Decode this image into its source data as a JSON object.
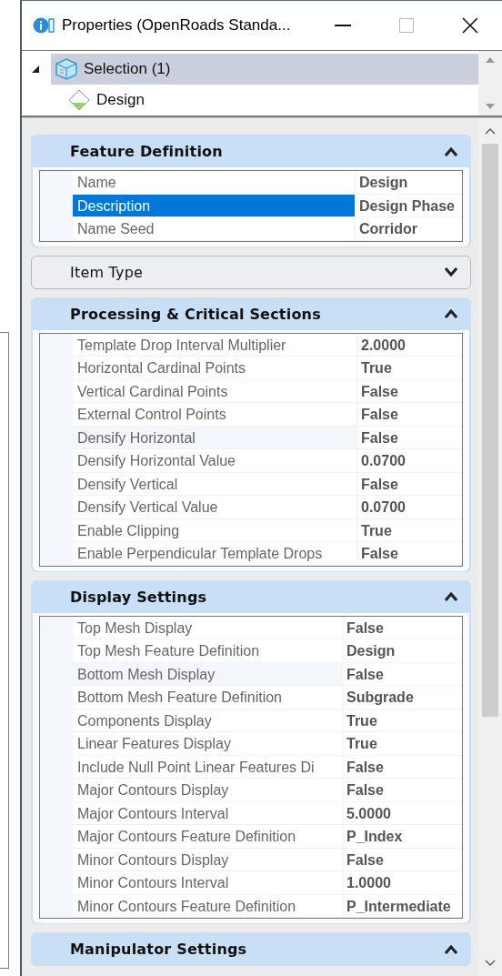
{
  "window": {
    "title": "Properties (OpenRoads Standa..."
  },
  "tree": {
    "items": [
      {
        "label": "Selection (1)",
        "selected": true,
        "expanded": true,
        "children": [
          {
            "label": "Design",
            "selected": false
          }
        ]
      }
    ]
  },
  "sections": [
    {
      "title": "Feature Definition",
      "expanded": true,
      "rows": [
        {
          "label": "Name",
          "value": "Design",
          "selected": false,
          "highlighted": false
        },
        {
          "label": "Description",
          "value": "Design Phase",
          "selected": true,
          "highlighted": false
        },
        {
          "label": "Name Seed",
          "value": "Corridor",
          "selected": false,
          "highlighted": false
        }
      ]
    },
    {
      "title": "Item Type",
      "expanded": false
    },
    {
      "title": "Processing & Critical Sections",
      "expanded": true,
      "rows": [
        {
          "label": "Template Drop Interval Multiplier",
          "value": "2.0000",
          "selected": false,
          "highlighted": false
        },
        {
          "label": "Horizontal Cardinal Points",
          "value": "True",
          "selected": false,
          "highlighted": false
        },
        {
          "label": "Vertical Cardinal Points",
          "value": "False",
          "selected": false,
          "highlighted": false
        },
        {
          "label": "External Control Points",
          "value": "False",
          "selected": false,
          "highlighted": false
        },
        {
          "label": "Densify Horizontal",
          "value": "False",
          "selected": false,
          "highlighted": true
        },
        {
          "label": "Densify Horizontal Value",
          "value": "0.0700",
          "selected": false,
          "highlighted": false
        },
        {
          "label": "Densify Vertical",
          "value": "False",
          "selected": false,
          "highlighted": false
        },
        {
          "label": "Densify Vertical Value",
          "value": "0.0700",
          "selected": false,
          "highlighted": false
        },
        {
          "label": "Enable Clipping",
          "value": "True",
          "selected": false,
          "highlighted": false
        },
        {
          "label": "Enable Perpendicular Template Drops",
          "value": "False",
          "selected": false,
          "highlighted": false
        }
      ]
    },
    {
      "title": "Display Settings",
      "expanded": true,
      "rows": [
        {
          "label": "Top Mesh Display",
          "value": "False",
          "selected": false,
          "highlighted": false
        },
        {
          "label": "Top Mesh Feature Definition",
          "value": "Design",
          "selected": false,
          "highlighted": false
        },
        {
          "label": "Bottom Mesh Display",
          "value": "False",
          "selected": false,
          "highlighted": true
        },
        {
          "label": "Bottom Mesh Feature Definition",
          "value": "Subgrade",
          "selected": false,
          "highlighted": false
        },
        {
          "label": "Components Display",
          "value": "True",
          "selected": false,
          "highlighted": false
        },
        {
          "label": "Linear Features Display",
          "value": "True",
          "selected": false,
          "highlighted": false
        },
        {
          "label": "Include Null Point Linear Features Di",
          "value": "False",
          "selected": false,
          "highlighted": false
        },
        {
          "label": "Major Contours Display",
          "value": "False",
          "selected": false,
          "highlighted": false
        },
        {
          "label": "Major Contours Interval",
          "value": "5.0000",
          "selected": false,
          "highlighted": false
        },
        {
          "label": "Major Contours Feature Definition",
          "value": "P_Index",
          "selected": false,
          "highlighted": false
        },
        {
          "label": "Minor Contours Display",
          "value": "False",
          "selected": false,
          "highlighted": false
        },
        {
          "label": "Minor Contours Interval",
          "value": "1.0000",
          "selected": false,
          "highlighted": false
        },
        {
          "label": "Minor Contours Feature Definition",
          "value": "P_Intermediate",
          "selected": false,
          "highlighted": false
        }
      ]
    },
    {
      "title": "Manipulator Settings",
      "expanded": true
    }
  ]
}
